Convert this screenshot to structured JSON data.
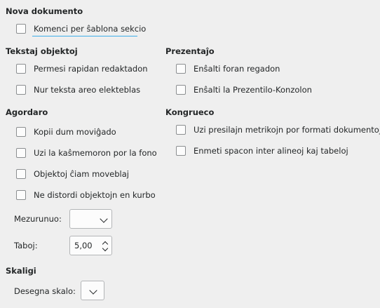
{
  "new_document": {
    "title": "Nova dokumento",
    "start_with_template": "Komenci per ŝablona sekcio"
  },
  "text_objects": {
    "title": "Tekstaj objektoj",
    "allow_quick_editing": "Permesi rapidan redaktadon",
    "only_text_area_selectable": "Nur teksta areo elekteblas"
  },
  "presentation": {
    "title": "Prezentaĵo",
    "enable_remote_control": "Enŝalti foran regadon",
    "enable_presenter_console": "Enŝalti la Prezentilo-Konzolon"
  },
  "settings": {
    "title": "Agordaro",
    "copy_when_moving": "Kopii dum moviĝado",
    "use_background_cache": "Uzi la kaŝmemoron por la fono",
    "objects_always_movable": "Objektoj ĉiam moveblaj",
    "no_distort_curve": "Ne distordi objektojn en kurbo",
    "unit_label": "Mezurunuo:",
    "unit_value": "",
    "tab_label": "Taboj:",
    "tab_value": "5,00"
  },
  "compatibility": {
    "title": "Kongrueco",
    "printer_metrics": "Uzi presilajn metrikojn por formati dokumentojn",
    "spacing_paragraphs_tables": "Enmeti spacon inter alineoj kaj tabeloj"
  },
  "scale": {
    "title": "Skaligi",
    "drawing_scale_label": "Desegna skalo:",
    "drawing_scale_value": ""
  }
}
